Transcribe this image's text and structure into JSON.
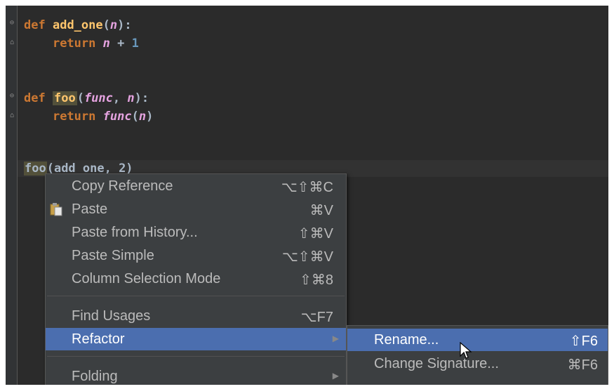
{
  "editor": {
    "line1": {
      "kw": "def",
      "name": "add_one",
      "open": "(",
      "param": "n",
      "close": "):"
    },
    "line2": {
      "kw": "return",
      "var": "n",
      "op": " + ",
      "num": "1"
    },
    "line3": {
      "kw": "def",
      "name": "foo",
      "open": "(",
      "p1": "func",
      "comma": ", ",
      "p2": "n",
      "close": "):"
    },
    "line4": {
      "kw": "return",
      "call": "func",
      "open": "(",
      "arg": "n",
      "close": ")"
    },
    "line5": {
      "name": "foo",
      "rest": "(add_one, 2)"
    }
  },
  "context_menu": {
    "items": [
      {
        "label": "Copy Reference",
        "shortcut": "⌥⇧⌘C"
      },
      {
        "label": "Paste",
        "shortcut": "⌘V",
        "icon": "clipboard-icon"
      },
      {
        "label": "Paste from History...",
        "shortcut": "⇧⌘V"
      },
      {
        "label": "Paste Simple",
        "shortcut": "⌥⇧⌘V"
      },
      {
        "label": "Column Selection Mode",
        "shortcut": "⇧⌘8"
      },
      {
        "label": "Find Usages",
        "shortcut": "⌥F7"
      },
      {
        "label": "Refactor",
        "shortcut": "",
        "submenu": true,
        "selected": true
      },
      {
        "label": "Folding",
        "shortcut": "",
        "submenu": true
      }
    ]
  },
  "submenu": {
    "items": [
      {
        "label": "Rename...",
        "shortcut": "⇧F6",
        "selected": true
      },
      {
        "label": "Change Signature...",
        "shortcut": "⌘F6"
      }
    ]
  },
  "colors": {
    "editor_bg": "#2b2b2b",
    "menu_bg": "#3c3f41",
    "selection": "#4b6eaf",
    "keyword": "#cc7832",
    "function": "#ffc66d",
    "parameter": "#e5a3e0",
    "number": "#6897bb"
  }
}
